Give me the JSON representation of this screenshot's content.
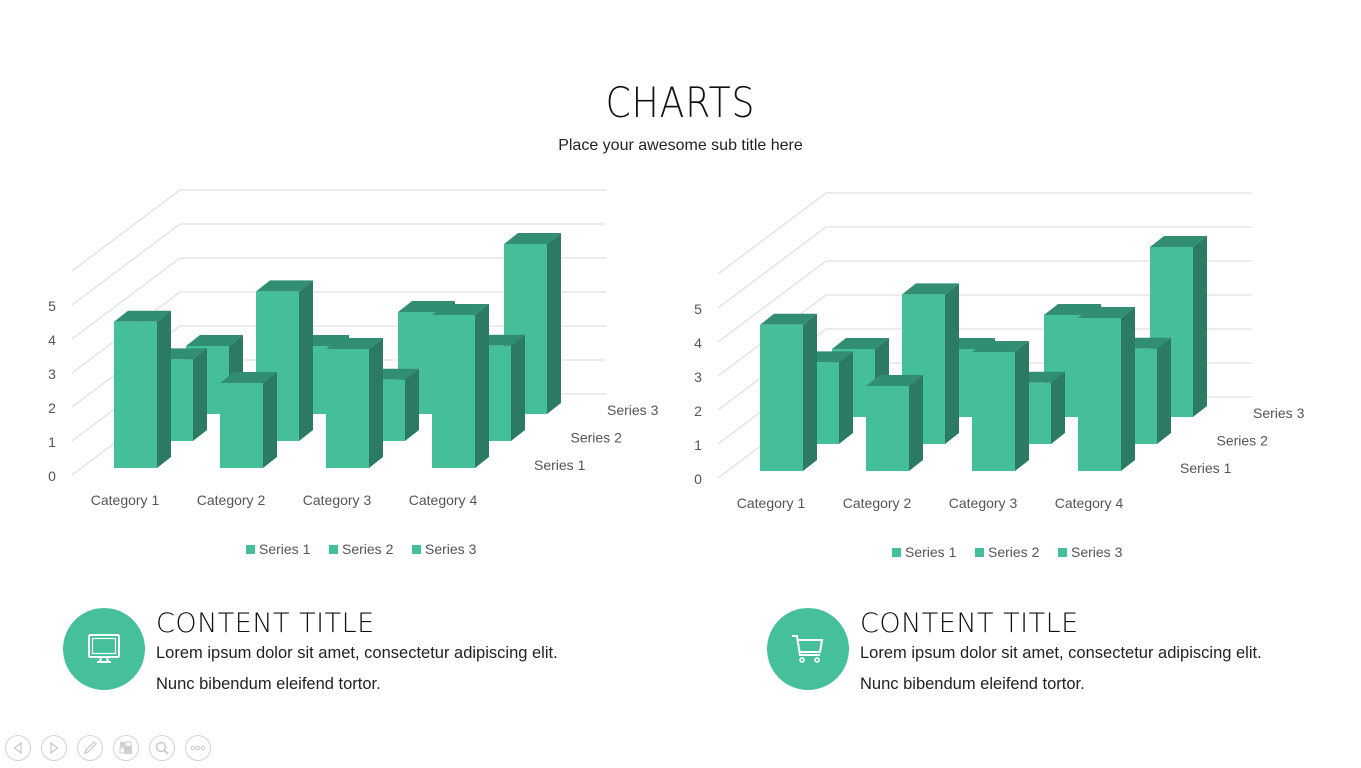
{
  "header": {
    "title": "CHARTS",
    "subtitle": "Place your awesome sub title here"
  },
  "colors": {
    "bar_front": "#45bf9a",
    "bar_side": "#2c7a63",
    "bar_top": "#318e72",
    "gridline": "#d9d9d9",
    "axis_text": "#595959",
    "icon_circle": "#46bf9b"
  },
  "chart_data": [
    {
      "type": "bar",
      "subtype": "3d-column",
      "categories": [
        "Category 1",
        "Category 2",
        "Category 3",
        "Category 4"
      ],
      "series": [
        {
          "name": "Series 1",
          "values": [
            4.3,
            2.5,
            3.5,
            4.5
          ]
        },
        {
          "name": "Series 2",
          "values": [
            2.4,
            4.4,
            1.8,
            2.8
          ]
        },
        {
          "name": "Series 3",
          "values": [
            2,
            2,
            3,
            5
          ]
        }
      ],
      "yticks": [
        "0",
        "1",
        "2",
        "3",
        "4",
        "5"
      ],
      "ylim": [
        0,
        7
      ],
      "grid": true,
      "legend": "bottom",
      "legend_entries": [
        "Series 1",
        "Series 2",
        "Series 3"
      ],
      "title": "",
      "xlabel": "",
      "ylabel": ""
    },
    {
      "type": "bar",
      "subtype": "3d-column",
      "categories": [
        "Category 1",
        "Category 2",
        "Category 3",
        "Category 4"
      ],
      "series": [
        {
          "name": "Series 1",
          "values": [
            4.3,
            2.5,
            3.5,
            4.5
          ]
        },
        {
          "name": "Series 2",
          "values": [
            2.4,
            4.4,
            1.8,
            2.8
          ]
        },
        {
          "name": "Series 3",
          "values": [
            2,
            2,
            3,
            5
          ]
        }
      ],
      "yticks": [
        "0",
        "1",
        "2",
        "3",
        "4",
        "5"
      ],
      "ylim": [
        0,
        7
      ],
      "grid": true,
      "legend": "bottom",
      "legend_entries": [
        "Series 1",
        "Series 2",
        "Series 3"
      ],
      "title": "",
      "xlabel": "",
      "ylabel": ""
    }
  ],
  "content_blocks": [
    {
      "icon": "monitor-icon",
      "title": "CONTENT TITLE",
      "line1": "Lorem ipsum dolor sit amet, consectetur adipiscing elit.",
      "line2": "Nunc bibendum eleifend tortor."
    },
    {
      "icon": "shopping-cart-icon",
      "title": "CONTENT TITLE",
      "line1": "Lorem ipsum dolor sit amet, consectetur adipiscing elit.",
      "line2": "Nunc bibendum eleifend tortor."
    }
  ],
  "navigation": [
    {
      "icon": "previous-icon",
      "label": "Previous"
    },
    {
      "icon": "next-icon",
      "label": "Next"
    },
    {
      "icon": "pen-icon",
      "label": "Pen"
    },
    {
      "icon": "slides-icon",
      "label": "Slides"
    },
    {
      "icon": "zoom-icon",
      "label": "Zoom"
    },
    {
      "icon": "more-icon",
      "label": "More"
    }
  ]
}
